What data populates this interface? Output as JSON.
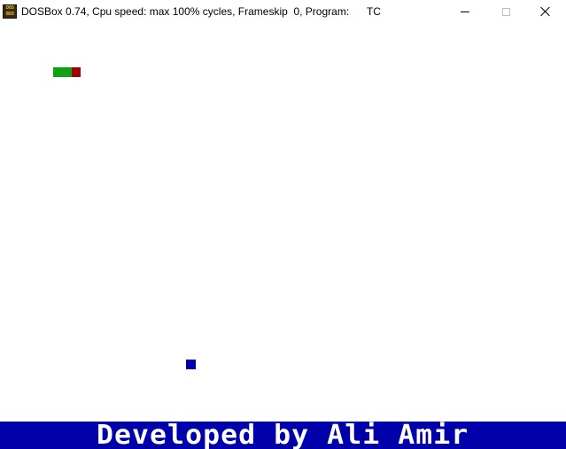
{
  "window": {
    "title": "DOSBox 0.74, Cpu speed: max 100% cycles, Frameskip  0, Program:      TC",
    "app_icon_text_top": "DOS",
    "app_icon_text_bottom": "BOX",
    "controls": {
      "minimize": "minimize-icon",
      "maximize": "maximize-icon",
      "close": "close-icon"
    }
  },
  "game": {
    "snake": {
      "body_color": "#10a010",
      "head_color": "#a00000"
    },
    "food": {
      "color": "#0000aa"
    },
    "footer": {
      "text": "Developed by Ali Amir",
      "background": "#0000aa",
      "text_color": "#ffffff"
    }
  }
}
